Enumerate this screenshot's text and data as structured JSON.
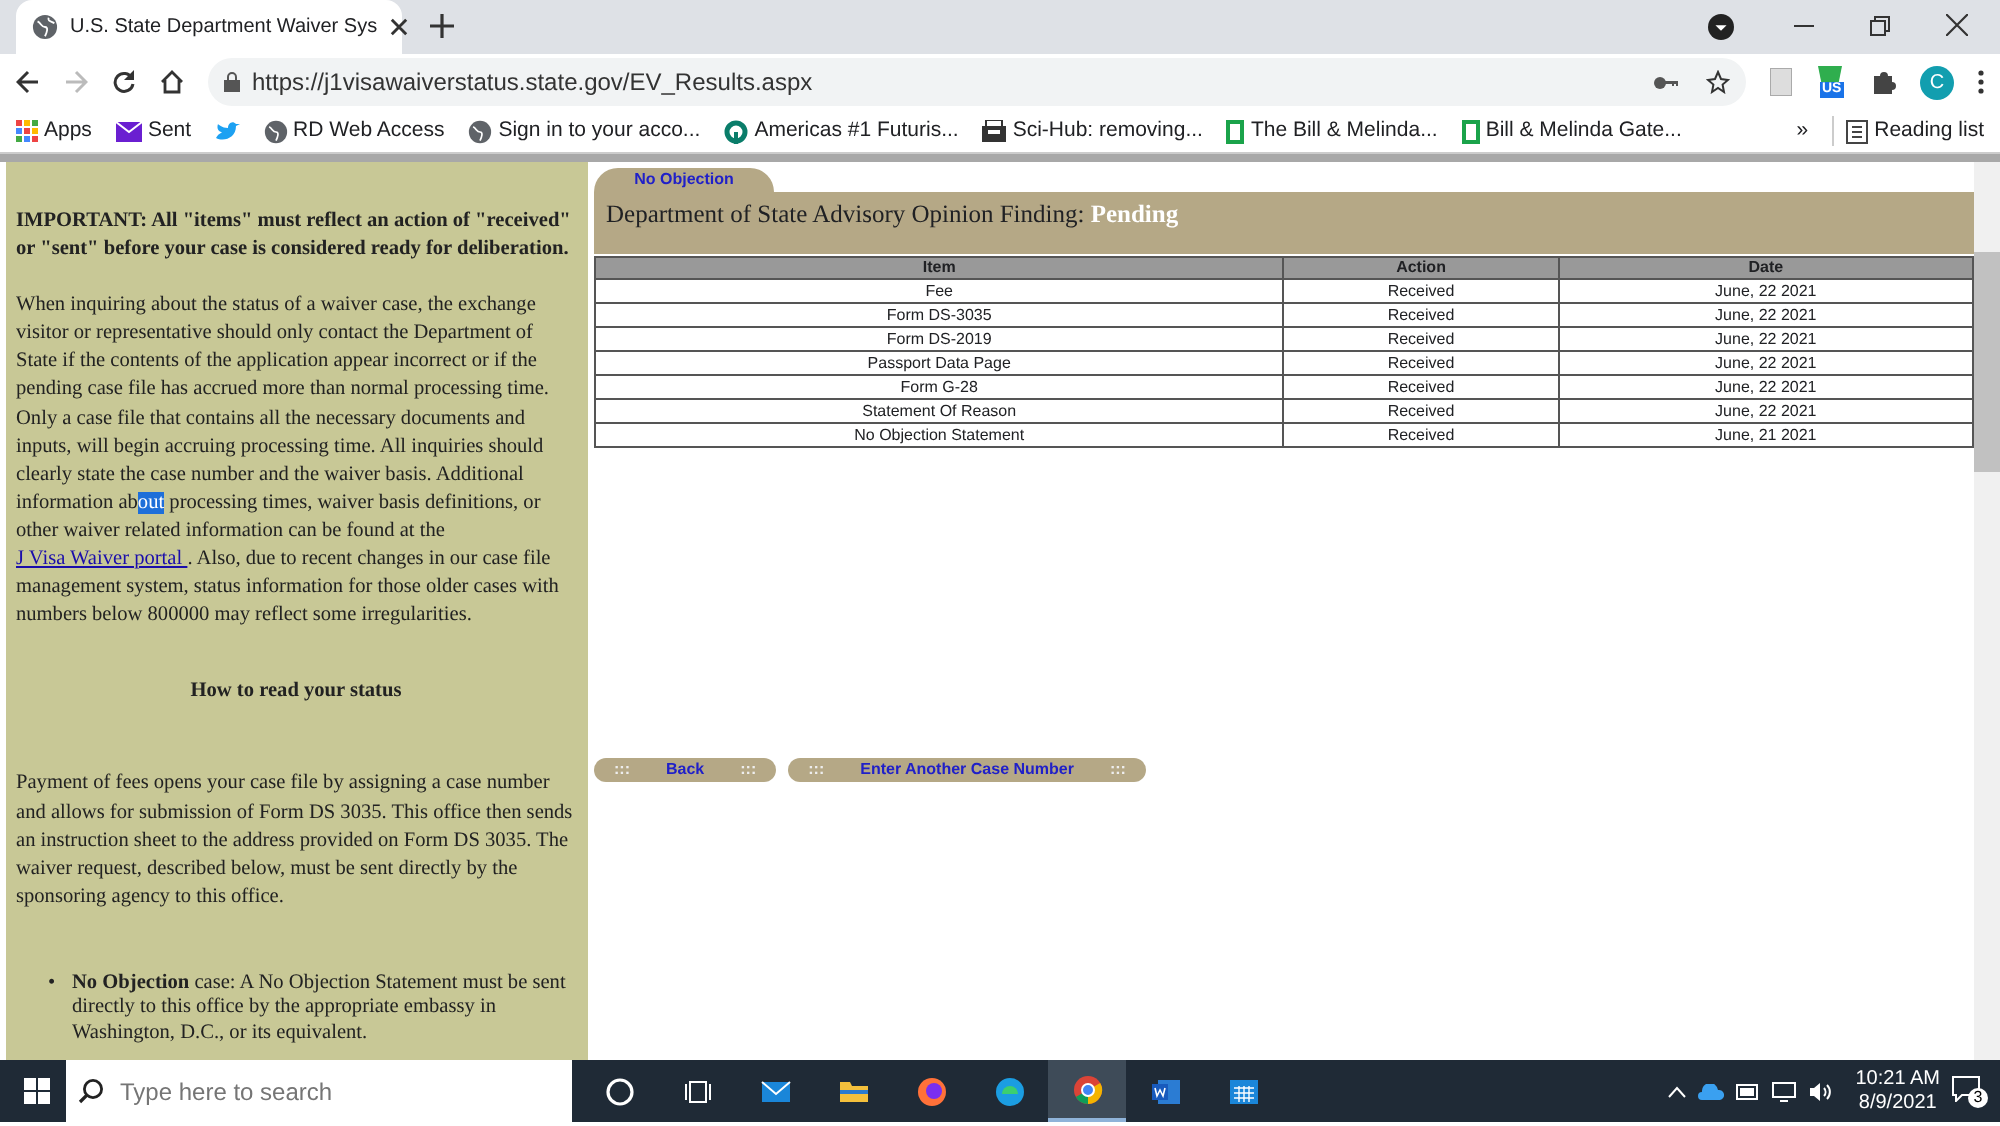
{
  "browser": {
    "tab_title": "U.S. State Department Waiver Sys",
    "url": "https://j1visawaiverstatus.state.gov/EV_Results.aspx",
    "profile_initial": "C",
    "extension_badge": "US",
    "bookmarks": [
      {
        "label": "Apps",
        "kind": "apps"
      },
      {
        "label": "Sent",
        "kind": "mail"
      },
      {
        "kind": "bird"
      },
      {
        "label": "RD Web Access",
        "kind": "globe"
      },
      {
        "label": "Sign in to your acco...",
        "kind": "globe"
      },
      {
        "label": "Americas #1 Futuris...",
        "kind": "ring"
      },
      {
        "label": "Sci-Hub: removing...",
        "kind": "box"
      },
      {
        "label": "The Bill & Melinda...",
        "kind": "page"
      },
      {
        "label": "Bill & Melinda Gate...",
        "kind": "page"
      }
    ],
    "overflow": "»",
    "reading_list": "Reading list"
  },
  "sidebar": {
    "important": "IMPORTANT: All \"items\" must reflect an action of \"received\" or \"sent\" before your case is considered ready for deliberation.",
    "paragraph": [
      {
        "kind": "plain",
        "text": "When inquiring about the status of a waiver case, the exchange visitor or representative should only contact the Department of State if the contents of the application appear incorrect or if the pending case file has accrued more than normal processing time.   Only a case file that contains all the necessary documents and inputs, will begin accruing processing time. All inquiries should clearly state the case number and the waiver basis.   Additional information ab"
      },
      {
        "kind": "selected",
        "text": "out"
      },
      {
        "kind": "plain",
        "text": " processing times, waiver basis definitions, or other waiver related information can be found at the "
      },
      {
        "kind": "link",
        "text": "J Visa Waiver portal "
      },
      {
        "kind": "plain",
        "text": ". Also, due to recent changes in our case file management system, status information for those older cases with numbers below 800000 may reflect some irregularities."
      }
    ],
    "heading": "How to read your status",
    "fees": "Payment of fees opens your case file by assigning a case number and allows for submission of Form DS 3035.  This office then sends an instruction sheet to the address provided on Form DS 3035.  The waiver request, described below, must be sent directly by the sponsoring agency to this office.",
    "bullet_marker": "•",
    "bullets": [
      "**No Objection** case: A No Objection Statement must be sent directly to this office by the appropriate embassy in Washington, D.C., or its equivalent."
    ]
  },
  "result": {
    "tab": "No Objection",
    "finding_label": "Department of State Advisory Opinion Finding:",
    "finding": "Pending",
    "table": {
      "columns": [
        "Item",
        "Action",
        "Date"
      ],
      "rows": [
        [
          "Fee",
          "Received",
          "June, 22 2021"
        ],
        [
          "Form DS-3035",
          "Received",
          "June, 22 2021"
        ],
        [
          "Form DS-2019",
          "Received",
          "June, 22 2021"
        ],
        [
          "Passport Data Page",
          "Received",
          "June, 22 2021"
        ],
        [
          "Form G-28",
          "Received",
          "June, 22 2021"
        ],
        [
          "Statement Of Reason",
          "Received",
          "June, 22 2021"
        ],
        [
          "No Objection Statement",
          "Received",
          "June, 21 2021"
        ]
      ]
    },
    "buttons": [
      {
        "label": "Back",
        "deco": ":::"
      },
      {
        "label": "Enter Another Case Number",
        "deco": ":::"
      }
    ]
  },
  "taskbar": {
    "search_placeholder": "Type here to search",
    "apps": [
      {
        "kind": "cortana",
        "selected": false
      },
      {
        "kind": "taskview",
        "selected": false
      },
      {
        "kind": "mail",
        "selected": false
      },
      {
        "kind": "folder",
        "selected": false
      },
      {
        "kind": "firefox",
        "selected": false
      },
      {
        "kind": "edge",
        "selected": false
      },
      {
        "kind": "chrome",
        "selected": true
      },
      {
        "kind": "word",
        "selected": false
      },
      {
        "kind": "calendar",
        "selected": false
      }
    ],
    "time": "10:21 AM",
    "date": "8/9/2021",
    "notifications": "3"
  }
}
